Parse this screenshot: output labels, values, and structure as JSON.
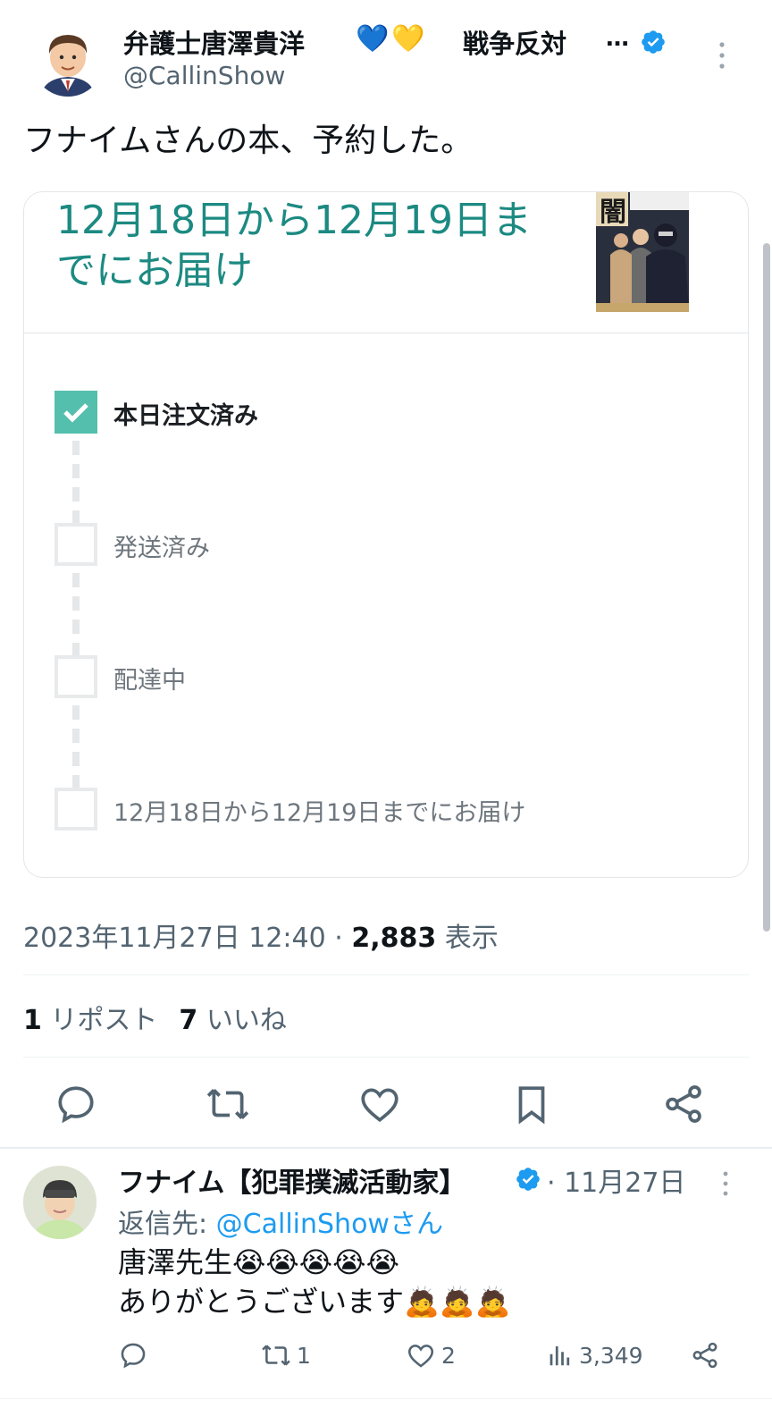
{
  "author": {
    "display_name": "弁護士唐澤貴洋",
    "hearts": [
      "💙",
      "💛"
    ],
    "tag": "戦争反対",
    "ellipsis": "…",
    "handle": "@CallinShow",
    "verified": true
  },
  "tweet": {
    "text": "フナイムさんの本、予約した。"
  },
  "card": {
    "delivery_title": "12月18日から12月19日までにお届け",
    "steps": [
      {
        "label": "本日注文済み",
        "done": true
      },
      {
        "label": "発送済み",
        "done": false
      },
      {
        "label": "配達中",
        "done": false
      },
      {
        "label": "12月18日から12月19日までにお届け",
        "done": false
      }
    ]
  },
  "meta": {
    "timestamp": "2023年11月27日 12:40",
    "separator": "·",
    "views_count": "2,883",
    "views_label": "表示"
  },
  "engagement": {
    "reposts_count": "1",
    "reposts_label": "リポスト",
    "likes_count": "7",
    "likes_label": "いいね"
  },
  "reply": {
    "display_name": "フナイム【犯罪撲滅活動家】",
    "verified": true,
    "date": "· 11月27日",
    "reply_to_prefix": "返信先: ",
    "reply_to_mention": "@CallinShowさん",
    "line1": "唐澤先生😭😭😭😭😭",
    "line2": "ありがとうございます🙇🙇🙇",
    "stats": {
      "reposts": "1",
      "likes": "2",
      "views": "3,349"
    }
  },
  "colors": {
    "accent_blue": "#1d9bf0",
    "delivery_teal": "#1c8a82",
    "check_green": "#55bfae",
    "muted_text": "#536471"
  }
}
